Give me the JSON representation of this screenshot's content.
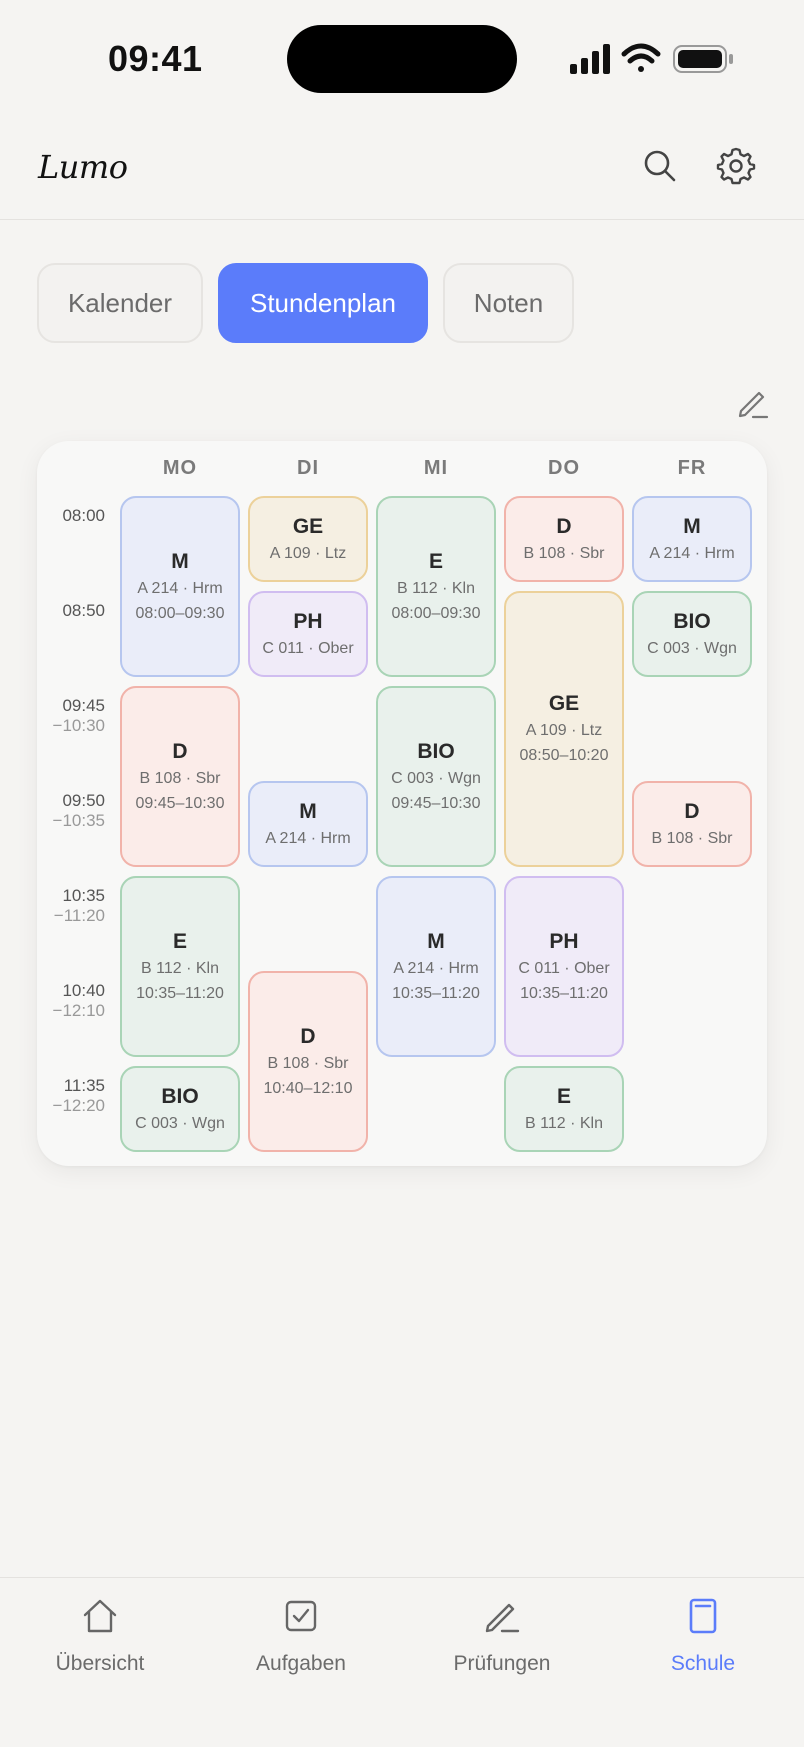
{
  "status": {
    "time": "09:41"
  },
  "app": {
    "logo": "Lumo"
  },
  "header": {
    "search_icon": "search-icon",
    "settings_icon": "gear-icon"
  },
  "segments": [
    {
      "label": "Kalender",
      "active": false
    },
    {
      "label": "Stundenplan",
      "active": true
    },
    {
      "label": "Noten",
      "active": false
    }
  ],
  "colors": {
    "accent": "#5b7cfa",
    "blue": "#b6c6ef",
    "yellow": "#ecd19a",
    "purple": "#d0bdf0",
    "green": "#a9d4b6",
    "red": "#f1b3aa"
  },
  "schedule": {
    "days": [
      "MO",
      "DI",
      "MI",
      "DO",
      "FR"
    ],
    "times": [
      {
        "main": "08:00",
        "sub": ""
      },
      {
        "main": "08:50",
        "sub": ""
      },
      {
        "main": "09:45",
        "sub": "−10:30"
      },
      {
        "main": "09:50",
        "sub": "−10:35"
      },
      {
        "main": "10:35",
        "sub": "−11:20"
      },
      {
        "main": "10:40",
        "sub": "−12:10"
      },
      {
        "main": "11:35",
        "sub": "−12:20"
      }
    ],
    "lessons": [
      {
        "subject": "M",
        "room": "A 214 · Hrm",
        "time": "08:00–09:30",
        "day": 0,
        "start": 0,
        "span": 2,
        "color": "blue"
      },
      {
        "subject": "D",
        "room": "B 108 · Sbr",
        "time": "09:45–10:30",
        "day": 0,
        "start": 2,
        "span": 2,
        "color": "red"
      },
      {
        "subject": "E",
        "room": "B 112 · Kln",
        "time": "10:35–11:20",
        "day": 0,
        "start": 4,
        "span": 2,
        "color": "green"
      },
      {
        "subject": "BIO",
        "room": "C 003 · Wgn",
        "time": "",
        "day": 0,
        "start": 6,
        "span": 1,
        "color": "green"
      },
      {
        "subject": "GE",
        "room": "A 109 · Ltz",
        "time": "",
        "day": 1,
        "start": 0,
        "span": 1,
        "color": "yellow"
      },
      {
        "subject": "PH",
        "room": "C 011 · Ober",
        "time": "",
        "day": 1,
        "start": 1,
        "span": 1,
        "color": "purple"
      },
      {
        "subject": "M",
        "room": "A 214 · Hrm",
        "time": "",
        "day": 1,
        "start": 3,
        "span": 1,
        "color": "blue"
      },
      {
        "subject": "D",
        "room": "B 108 · Sbr",
        "time": "10:40–12:10",
        "day": 1,
        "start": 5,
        "span": 2,
        "color": "red"
      },
      {
        "subject": "E",
        "room": "B 112 · Kln",
        "time": "08:00–09:30",
        "day": 2,
        "start": 0,
        "span": 2,
        "color": "green"
      },
      {
        "subject": "BIO",
        "room": "C 003 · Wgn",
        "time": "09:45–10:30",
        "day": 2,
        "start": 2,
        "span": 2,
        "color": "green"
      },
      {
        "subject": "M",
        "room": "A 214 · Hrm",
        "time": "10:35–11:20",
        "day": 2,
        "start": 4,
        "span": 2,
        "color": "blue"
      },
      {
        "subject": "D",
        "room": "B 108 · Sbr",
        "time": "",
        "day": 3,
        "start": 0,
        "span": 1,
        "color": "red"
      },
      {
        "subject": "GE",
        "room": "A 109 · Ltz",
        "time": "08:50–10:20",
        "day": 3,
        "start": 1,
        "span": 3,
        "color": "yellow"
      },
      {
        "subject": "PH",
        "room": "C 011 · Ober",
        "time": "10:35–11:20",
        "day": 3,
        "start": 4,
        "span": 2,
        "color": "purple"
      },
      {
        "subject": "E",
        "room": "B 112 · Kln",
        "time": "",
        "day": 3,
        "start": 6,
        "span": 1,
        "color": "green"
      },
      {
        "subject": "M",
        "room": "A 214 · Hrm",
        "time": "",
        "day": 4,
        "start": 0,
        "span": 1,
        "color": "blue"
      },
      {
        "subject": "BIO",
        "room": "C 003 · Wgn",
        "time": "",
        "day": 4,
        "start": 1,
        "span": 1,
        "color": "green"
      },
      {
        "subject": "D",
        "room": "B 108 · Sbr",
        "time": "",
        "day": 4,
        "start": 3,
        "span": 1,
        "color": "red"
      }
    ]
  },
  "tabbar": [
    {
      "label": "Übersicht",
      "icon": "home-icon",
      "active": false
    },
    {
      "label": "Aufgaben",
      "icon": "checkbox-icon",
      "active": false
    },
    {
      "label": "Prüfungen",
      "icon": "pencil-icon",
      "active": false
    },
    {
      "label": "Schule",
      "icon": "book-icon",
      "active": true
    }
  ]
}
